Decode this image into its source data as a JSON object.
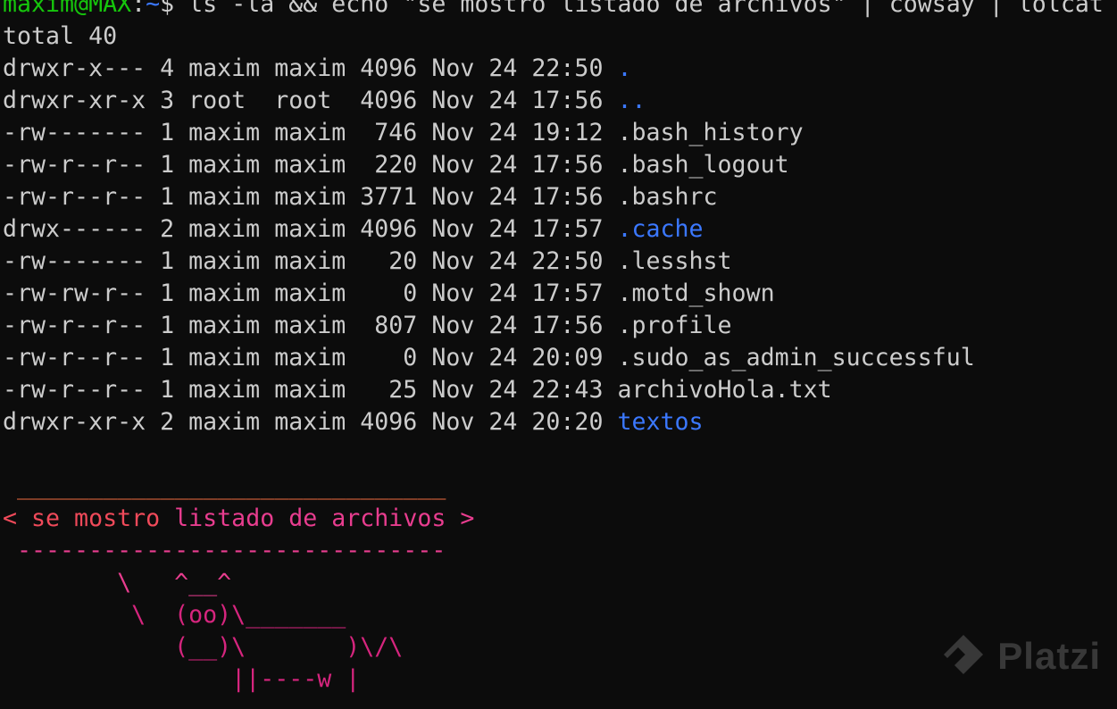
{
  "prompt": {
    "user_host": "maxim@MAX",
    "separator": ":",
    "path": "~",
    "symbol": "$",
    "command": " ls -la && echo \"se mostro listado de archivos\" | cowsay | lolcat"
  },
  "listing": {
    "total": "total 40",
    "rows": [
      {
        "meta": "drwxr-x--- 4 maxim maxim 4096 Nov 24 22:50 ",
        "name": ".",
        "is_dir": true
      },
      {
        "meta": "drwxr-xr-x 3 root  root  4096 Nov 24 17:56 ",
        "name": "..",
        "is_dir": true
      },
      {
        "meta": "-rw------- 1 maxim maxim  746 Nov 24 19:12 ",
        "name": ".bash_history",
        "is_dir": false
      },
      {
        "meta": "-rw-r--r-- 1 maxim maxim  220 Nov 24 17:56 ",
        "name": ".bash_logout",
        "is_dir": false
      },
      {
        "meta": "-rw-r--r-- 1 maxim maxim 3771 Nov 24 17:56 ",
        "name": ".bashrc",
        "is_dir": false
      },
      {
        "meta": "drwx------ 2 maxim maxim 4096 Nov 24 17:57 ",
        "name": ".cache",
        "is_dir": true
      },
      {
        "meta": "-rw------- 1 maxim maxim   20 Nov 24 22:50 ",
        "name": ".lesshst",
        "is_dir": false
      },
      {
        "meta": "-rw-rw-r-- 1 maxim maxim    0 Nov 24 17:57 ",
        "name": ".motd_shown",
        "is_dir": false
      },
      {
        "meta": "-rw-r--r-- 1 maxim maxim  807 Nov 24 17:56 ",
        "name": ".profile",
        "is_dir": false
      },
      {
        "meta": "-rw-r--r-- 1 maxim maxim    0 Nov 24 20:09 ",
        "name": ".sudo_as_admin_successful",
        "is_dir": false
      },
      {
        "meta": "-rw-r--r-- 1 maxim maxim   25 Nov 24 22:43 ",
        "name": "archivoHola.txt",
        "is_dir": false
      },
      {
        "meta": "drwxr-xr-x 2 maxim maxim 4096 Nov 24 20:20 ",
        "name": "textos",
        "is_dir": true
      }
    ]
  },
  "cowsay": {
    "top_border": " ______________________________",
    "message_a": "< se mostro ",
    "message_b": "listado de archivos >",
    "bottom_border": " ------------------------------",
    "cow_line_1": "        \\   ^__^",
    "cow_line_2": "         \\  (oo)\\_______",
    "cow_line_3": "            (__)\\       )\\/\\",
    "cow_line_4": "                ||----w |",
    "cow_line_5": "                ||     ||"
  },
  "watermark": {
    "text": "Platzi"
  },
  "colors": {
    "background": "#0c0c0c",
    "foreground": "#cccccc",
    "prompt_user": "#16c60c",
    "prompt_path": "#3b78ff",
    "directory": "#3b78ff"
  }
}
